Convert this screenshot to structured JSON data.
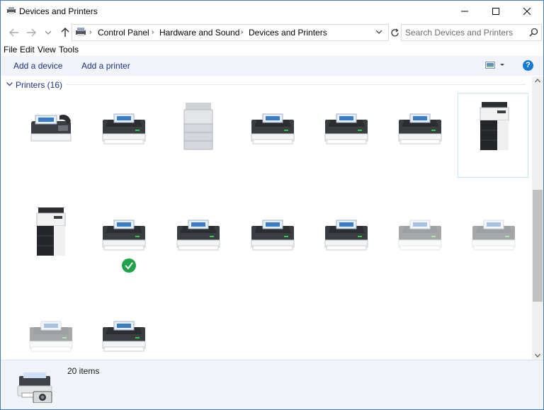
{
  "window": {
    "title": "Devices and Printers"
  },
  "address": {
    "crumbs": [
      "Control Panel",
      "Hardware and Sound",
      "Devices and Printers"
    ]
  },
  "search": {
    "placeholder": "Search Devices and Printers"
  },
  "menu": [
    "File",
    "Edit",
    "View",
    "Tools"
  ],
  "commands": {
    "add_device": "Add a device",
    "add_printer": "Add a printer"
  },
  "group": {
    "label": "Printers (16)"
  },
  "devices": [
    {
      "kind": "fax",
      "label": ""
    },
    {
      "kind": "printer",
      "label": ""
    },
    {
      "kind": "copier-gray",
      "label": ""
    },
    {
      "kind": "printer",
      "label": ""
    },
    {
      "kind": "printer",
      "label": ""
    },
    {
      "kind": "printer",
      "label": ""
    },
    {
      "kind": "copier-black",
      "label": "",
      "selected": true
    },
    {
      "kind": "copier-black",
      "label": ""
    },
    {
      "kind": "printer",
      "label": "",
      "default": true
    },
    {
      "kind": "printer",
      "label": ""
    },
    {
      "kind": "printer",
      "label": ""
    },
    {
      "kind": "printer",
      "label": ""
    },
    {
      "kind": "printer-faded",
      "label": ""
    },
    {
      "kind": "printer-faded",
      "label": ""
    },
    {
      "kind": "printer-faded",
      "label": ""
    },
    {
      "kind": "printer",
      "label": ""
    }
  ],
  "details": {
    "count": "20 items"
  }
}
